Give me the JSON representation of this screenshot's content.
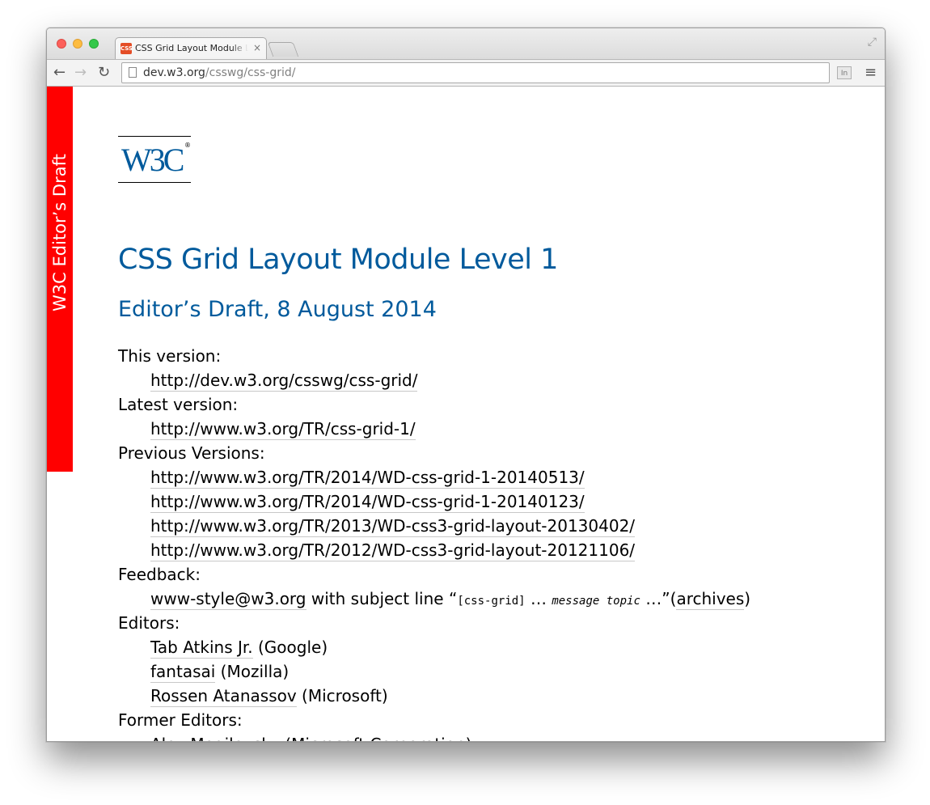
{
  "browser": {
    "tab_title": "CSS Grid Layout Module Le",
    "tab_close": "×",
    "favicon_text": "CSS",
    "url_host": "dev.w3.org",
    "url_path": "/csswg/css-grid/",
    "ext_label": "In"
  },
  "sidebar": {
    "banner_text": "W3C Editor’s Draft",
    "banner_color": "#ff0000"
  },
  "logo": {
    "text": "W3C",
    "reg": "®"
  },
  "page": {
    "title": "CSS Grid Layout Module Level 1",
    "subtitle": "Editor’s Draft, 8 August 2014",
    "this_version_label": "This version:",
    "this_version": "http://dev.w3.org/csswg/css-grid/",
    "latest_version_label": "Latest version:",
    "latest_version": "http://www.w3.org/TR/css-grid-1/",
    "previous_versions_label": "Previous Versions:",
    "previous_versions": [
      "http://www.w3.org/TR/2014/WD-css-grid-1-20140513/",
      "http://www.w3.org/TR/2014/WD-css-grid-1-20140123/",
      "http://www.w3.org/TR/2013/WD-css3-grid-layout-20130402/",
      "http://www.w3.org/TR/2012/WD-css3-grid-layout-20121106/"
    ],
    "feedback_label": "Feedback:",
    "feedback_email": "www-style@w3.org",
    "feedback_text1": " with subject line “",
    "feedback_tag": "[css-grid]",
    "feedback_ellipsis1": " … ",
    "feedback_topic": "message topic",
    "feedback_ellipsis2": " …”(",
    "feedback_archives": "archives",
    "feedback_close": ")",
    "editors_label": "Editors:",
    "editors": [
      {
        "name": "Tab Atkins Jr.",
        "org": " (Google)"
      },
      {
        "name": "fantasai",
        "org": " (Mozilla)"
      },
      {
        "name": "Rossen Atanassov",
        "org": " (Microsoft)"
      }
    ],
    "former_editors_label": "Former Editors:",
    "former_editor": "Alex Mogilevsky (Microsoft Corporation)"
  }
}
